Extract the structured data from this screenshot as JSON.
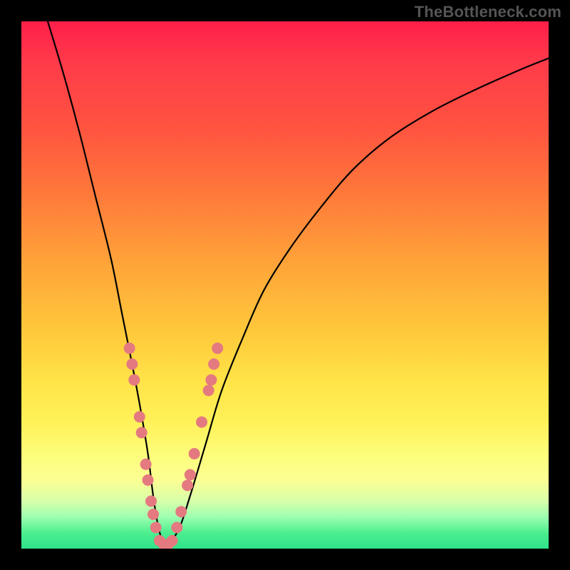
{
  "watermark": "TheBottleneck.com",
  "chart_data": {
    "type": "line",
    "title": "",
    "xlabel": "",
    "ylabel": "",
    "xlim": [
      0,
      100
    ],
    "ylim": [
      0,
      100
    ],
    "series": [
      {
        "name": "bottleneck-curve",
        "x": [
          5,
          8,
          11,
          14,
          17,
          19,
          21,
          22.5,
          24,
          25,
          26,
          27,
          28,
          30,
          32,
          35,
          38,
          42,
          46,
          51,
          57,
          63,
          70,
          78,
          86,
          95,
          100
        ],
        "values": [
          100,
          90,
          79,
          67,
          55,
          45,
          35,
          27,
          18,
          10,
          4,
          1,
          1,
          4,
          10,
          20,
          30,
          40,
          49,
          57,
          65,
          72,
          78,
          83,
          87,
          91,
          93
        ]
      }
    ],
    "markers": {
      "name": "highlight-dots",
      "color": "#e47a80",
      "points": [
        {
          "x": 20.5,
          "y": 38
        },
        {
          "x": 21.0,
          "y": 35
        },
        {
          "x": 21.4,
          "y": 32
        },
        {
          "x": 22.4,
          "y": 25
        },
        {
          "x": 22.8,
          "y": 22
        },
        {
          "x": 23.6,
          "y": 16
        },
        {
          "x": 24.0,
          "y": 13
        },
        {
          "x": 24.6,
          "y": 9
        },
        {
          "x": 25.0,
          "y": 6.5
        },
        {
          "x": 25.5,
          "y": 4
        },
        {
          "x": 26.2,
          "y": 1.5
        },
        {
          "x": 27.0,
          "y": 0.8
        },
        {
          "x": 27.8,
          "y": 0.8
        },
        {
          "x": 28.6,
          "y": 1.5
        },
        {
          "x": 29.5,
          "y": 4
        },
        {
          "x": 30.3,
          "y": 7
        },
        {
          "x": 31.5,
          "y": 12
        },
        {
          "x": 32.0,
          "y": 14
        },
        {
          "x": 32.8,
          "y": 18
        },
        {
          "x": 34.2,
          "y": 24
        },
        {
          "x": 35.5,
          "y": 30
        },
        {
          "x": 36.0,
          "y": 32
        },
        {
          "x": 36.5,
          "y": 35
        },
        {
          "x": 37.2,
          "y": 38
        }
      ]
    },
    "gradient_stops": [
      {
        "pos": 0.0,
        "color": "#ff1f4a"
      },
      {
        "pos": 0.5,
        "color": "#ffc63a"
      },
      {
        "pos": 0.85,
        "color": "#fdfd7a"
      },
      {
        "pos": 1.0,
        "color": "#2ee38a"
      }
    ]
  }
}
